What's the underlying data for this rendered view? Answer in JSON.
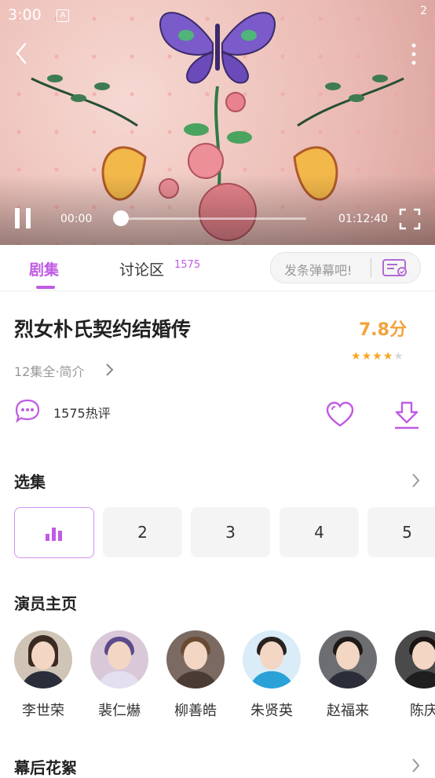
{
  "status": {
    "time": "3:00",
    "right": "2"
  },
  "player": {
    "current_time": "00:00",
    "total_time": "01:12:40",
    "progress": 0.0
  },
  "tabs": {
    "episodes_label": "剧集",
    "discussion_label": "讨论区",
    "discussion_count": "1575",
    "danmaku_placeholder": "发条弹幕吧!"
  },
  "show": {
    "title": "烈女朴氏契约结婚传",
    "score": "7.8分",
    "rating_stars": 4,
    "meta": "12集全·简介",
    "comments": "1575热评"
  },
  "episodes": {
    "section_title": "选集",
    "items": [
      "2",
      "3",
      "4",
      "5"
    ]
  },
  "actors": {
    "section_title": "演员主页",
    "items": [
      "李世荣",
      "裴仁爀",
      "柳善皓",
      "朱贤英",
      "赵福来",
      "陈庆"
    ]
  },
  "behind": {
    "section_title": "幕后花絮"
  },
  "colors": {
    "accent": "#c05be3",
    "score": "#f2a33a",
    "star": "#f5a623"
  },
  "icons": [
    "back-icon",
    "more-icon",
    "pause-icon",
    "fullscreen-icon",
    "danmaku-icon",
    "comment-icon",
    "heart-icon",
    "download-icon",
    "chevron-right-icon",
    "playing-bars-icon"
  ]
}
